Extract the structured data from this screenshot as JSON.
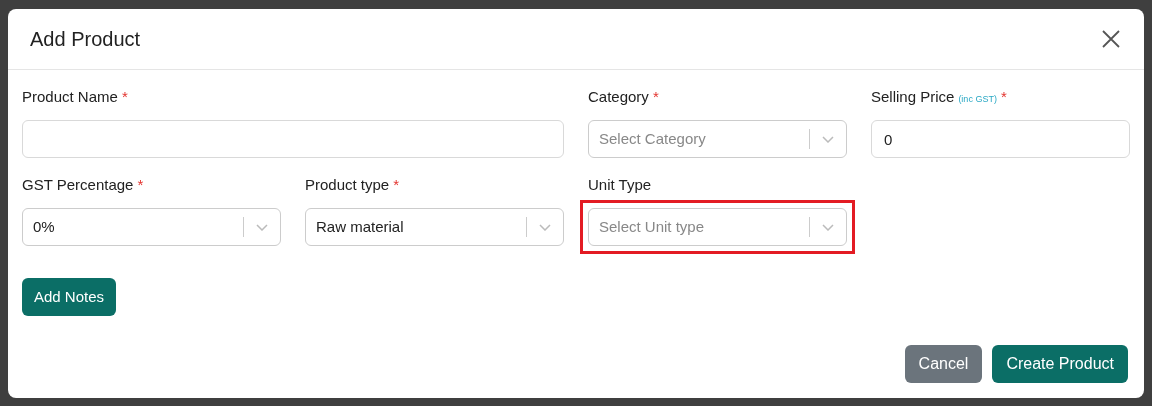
{
  "dialog": {
    "title": "Add Product",
    "fields": [
      {
        "kind": "text",
        "label": "Product Name",
        "required_mark": "*"
      },
      {
        "kind": "select",
        "label": "Category",
        "required_mark": "*",
        "placeholder": "Select Category",
        "highlighted": false
      },
      {
        "kind": "text",
        "label": "Selling Price",
        "note": "(inc GST)",
        "required_mark": "*",
        "value": "0"
      },
      {
        "kind": "select",
        "label": "GST Percentage",
        "required_mark": "*",
        "value": "0%",
        "highlighted": false
      },
      {
        "kind": "select",
        "label": "Product type",
        "required_mark": "*",
        "value": "Raw material",
        "highlighted": false
      },
      {
        "kind": "select",
        "label": "Unit Type",
        "placeholder": "Select Unit type",
        "highlighted": true
      }
    ],
    "notes_button": "Add Notes",
    "buttons": [
      {
        "label": "Cancel",
        "kind": "secondary"
      },
      {
        "label": "Create Product",
        "kind": "primary"
      }
    ]
  }
}
